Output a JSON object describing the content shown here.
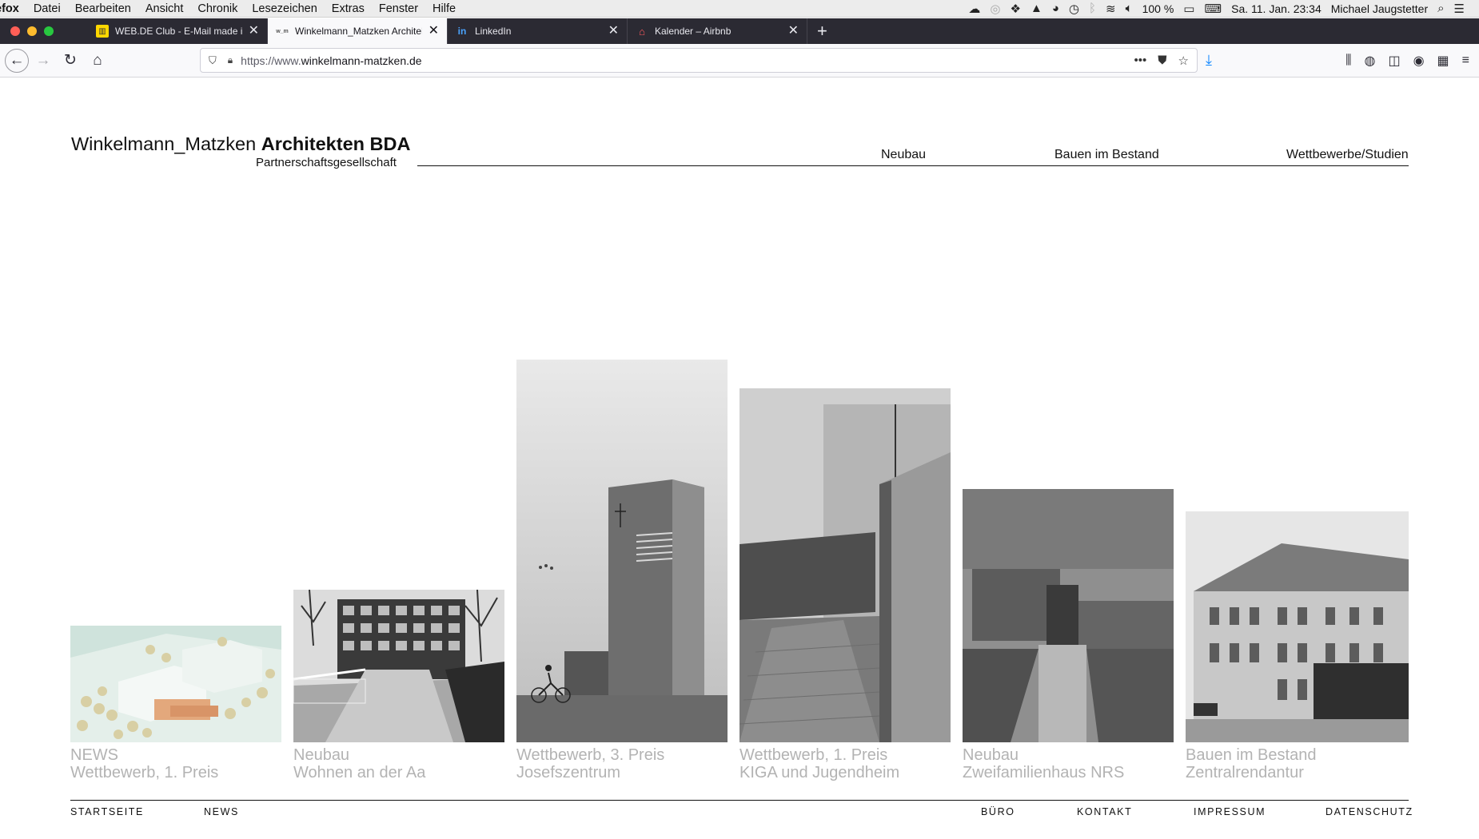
{
  "menubar": {
    "app_name": "efox",
    "items": [
      "Datei",
      "Bearbeiten",
      "Ansicht",
      "Chronik",
      "Lesezeichen",
      "Extras",
      "Fenster",
      "Hilfe"
    ],
    "battery": "100 %",
    "datetime": "Sa. 11. Jan.  23:34",
    "user": "Michael Jaugstetter"
  },
  "tabs": [
    {
      "title": "WEB.DE Club - E-Mail made in G",
      "favicon": "webde-icon",
      "active": false
    },
    {
      "title": "Winkelmann_Matzken Architekten",
      "favicon": "wm-icon",
      "active": true
    },
    {
      "title": "LinkedIn",
      "favicon": "linkedin-icon",
      "active": false
    },
    {
      "title": "Kalender – Airbnb",
      "favicon": "airbnb-icon",
      "active": false
    }
  ],
  "urlbar": {
    "prefix": "https://www.",
    "domain": "winkelmann-matzken.de"
  },
  "site": {
    "brand_name": "Winkelmann_Matzken",
    "brand_bold": "Architekten BDA",
    "brand_sub": "Partnerschaftsgesellschaft",
    "nav": [
      "Neubau",
      "Bauen im Bestand",
      "Wettbewerbe/Studien"
    ],
    "projects": [
      {
        "line1": "NEWS",
        "line2": "Wettbewerb, 1. Preis"
      },
      {
        "line1": "Neubau",
        "line2": "Wohnen an der Aa"
      },
      {
        "line1": "Wettbewerb, 3. Preis",
        "line2": "Josefszentrum"
      },
      {
        "line1": "Wettbewerb, 1. Preis",
        "line2": "KIGA und Jugendheim"
      },
      {
        "line1": "Neubau",
        "line2": "Zweifamilienhaus NRS"
      },
      {
        "line1": "Bauen im Bestand",
        "line2": "Zentralrendantur"
      }
    ],
    "footer": [
      "STARTSEITE",
      "NEWS",
      "BÜRO",
      "KONTAKT",
      "IMPRESSUM",
      "DATENSCHUTZ"
    ]
  },
  "colors": {
    "tabbar": "#2b2a33",
    "caption": "#b3b3b3",
    "accent_download": "#0a84ff"
  }
}
